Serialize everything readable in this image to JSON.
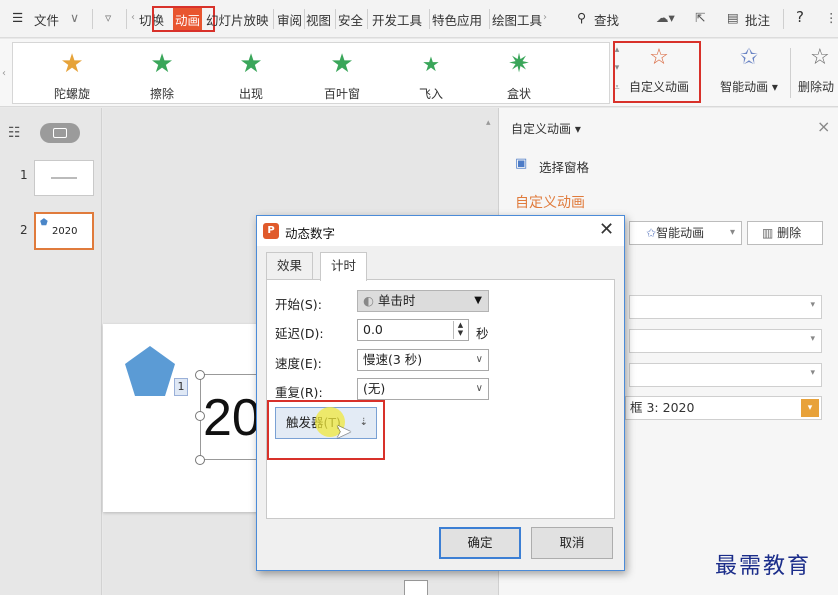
{
  "menubar": {
    "hamburger": "☰",
    "file": "文件",
    "items": [
      "切换",
      "动画",
      "幻灯片放映",
      "审阅",
      "视图",
      "安全",
      "开发工具",
      "特色应用",
      "绘图工具"
    ],
    "search": "查找",
    "comment": "批注",
    "help": "?"
  },
  "ribbon": {
    "effects": [
      "陀螺旋",
      "擦除",
      "出现",
      "百叶窗",
      "飞入",
      "盒状"
    ],
    "custom_animation": "自定义动画",
    "smart_animation": "智能动画",
    "delete_animation": "删除动"
  },
  "thumbs": {
    "slides": [
      {
        "num": "1",
        "text": ""
      },
      {
        "num": "2",
        "text": "2020"
      }
    ]
  },
  "canvas": {
    "shape_label": "1",
    "text": "20"
  },
  "taskpane": {
    "header": "自定义动画",
    "select_pane": "选择窗格",
    "section_title": "自定义动画",
    "smart_btn": "智能动画",
    "delete_btn": "删除",
    "list_item": "框 3: 2020"
  },
  "dialog": {
    "title": "动态数字",
    "tabs": [
      "效果",
      "计时"
    ],
    "start_label": "开始(S):",
    "start_value": "单击时",
    "delay_label": "延迟(D):",
    "delay_value": "0.0",
    "delay_unit": "秒",
    "speed_label": "速度(E):",
    "speed_value": "慢速(3 秒)",
    "repeat_label": "重复(R):",
    "repeat_value": "(无)",
    "trigger_btn": "触发器(T)",
    "ok": "确定",
    "cancel": "取消"
  },
  "watermark": "最需教育"
}
